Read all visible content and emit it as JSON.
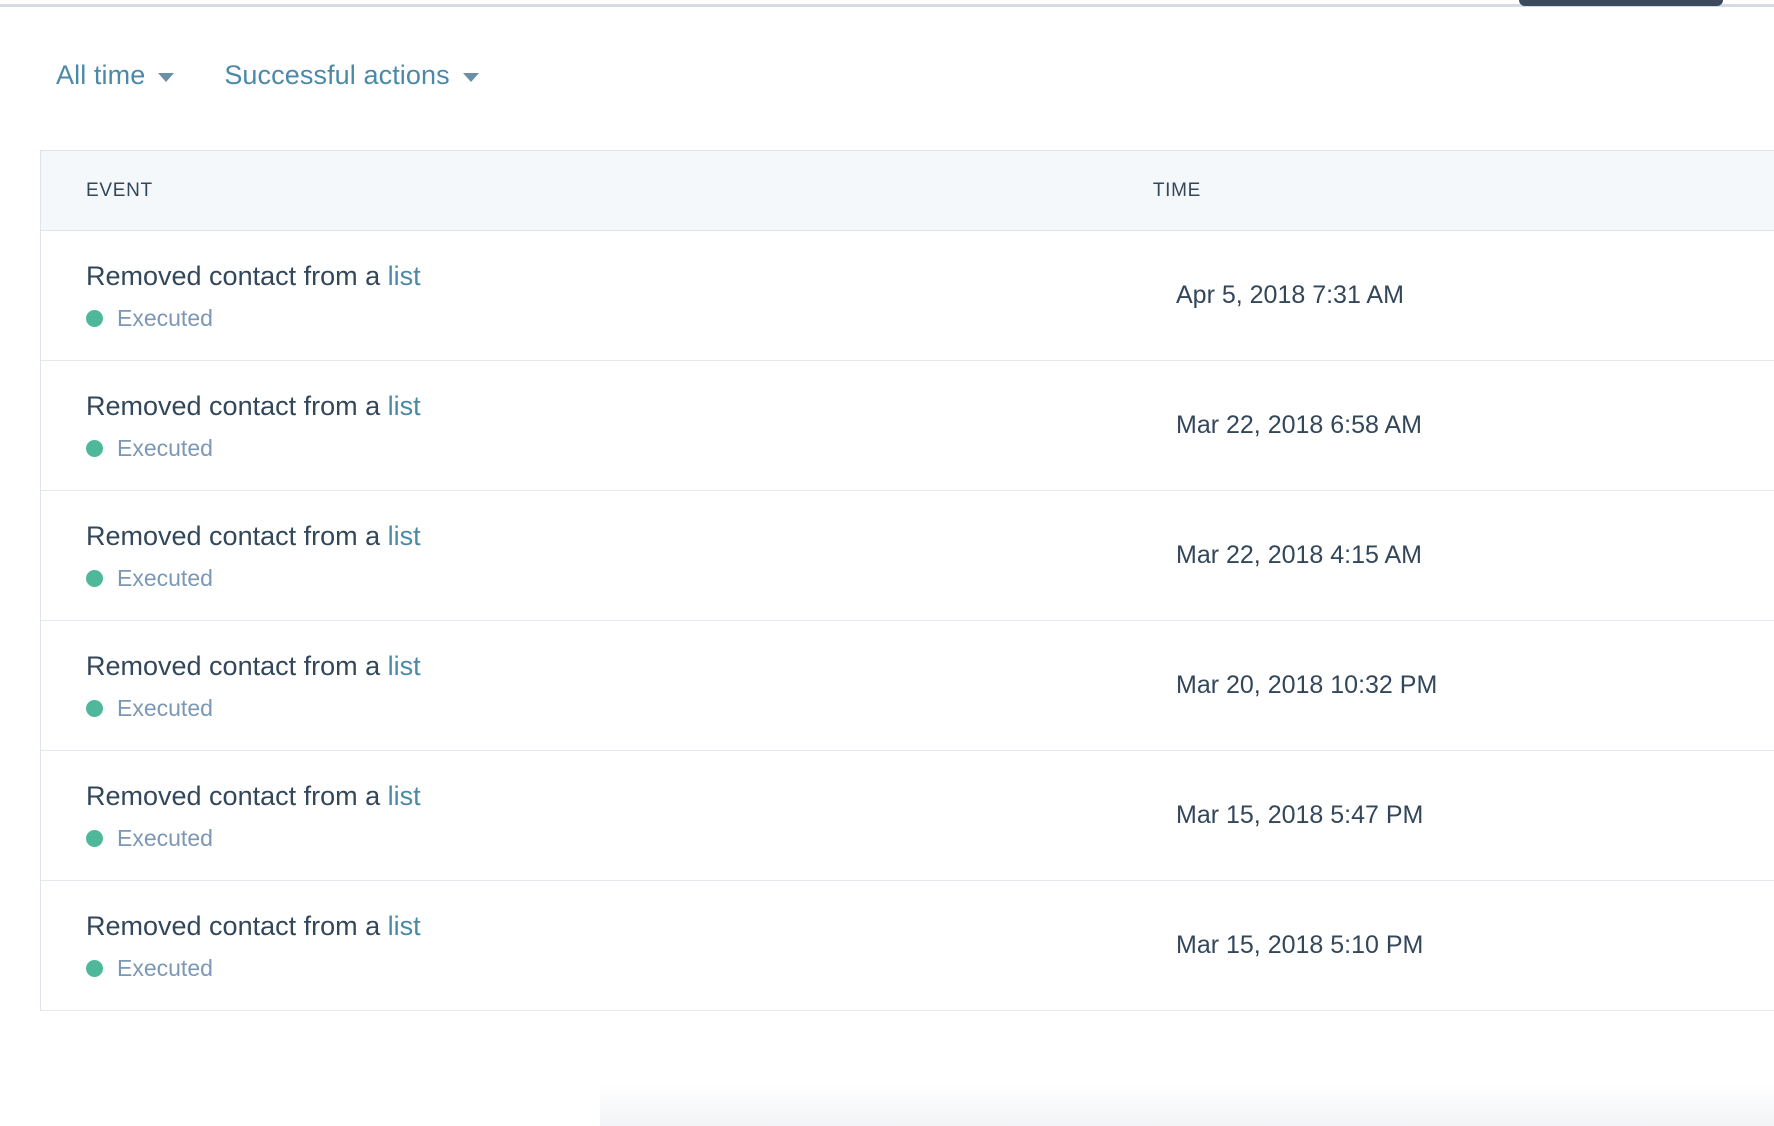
{
  "colors": {
    "link": "#4a89a8",
    "text_primary": "#33475b",
    "text_muted": "#7c98b6",
    "status_executed": "#4fb89a",
    "header_bg": "#f5f8fa",
    "border": "#dfe3eb",
    "pill_dark": "#3b4a5c"
  },
  "filters": [
    {
      "label": "All time",
      "icon": "chevron-down-icon"
    },
    {
      "label": "Successful actions",
      "icon": "chevron-down-icon"
    }
  ],
  "table": {
    "columns": {
      "event": "EVENT",
      "time": "TIME"
    },
    "rows": [
      {
        "event_prefix": "Removed contact from a",
        "event_link": "list",
        "status": "Executed",
        "status_color": "#4fb89a",
        "time": "Apr 5, 2018 7:31 AM"
      },
      {
        "event_prefix": "Removed contact from a",
        "event_link": "list",
        "status": "Executed",
        "status_color": "#4fb89a",
        "time": "Mar 22, 2018 6:58 AM"
      },
      {
        "event_prefix": "Removed contact from a",
        "event_link": "list",
        "status": "Executed",
        "status_color": "#4fb89a",
        "time": "Mar 22, 2018 4:15 AM"
      },
      {
        "event_prefix": "Removed contact from a",
        "event_link": "list",
        "status": "Executed",
        "status_color": "#4fb89a",
        "time": "Mar 20, 2018 10:32 PM"
      },
      {
        "event_prefix": "Removed contact from a",
        "event_link": "list",
        "status": "Executed",
        "status_color": "#4fb89a",
        "time": "Mar 15, 2018 5:47 PM"
      },
      {
        "event_prefix": "Removed contact from a",
        "event_link": "list",
        "status": "Executed",
        "status_color": "#4fb89a",
        "time": "Mar 15, 2018 5:10 PM"
      }
    ]
  }
}
